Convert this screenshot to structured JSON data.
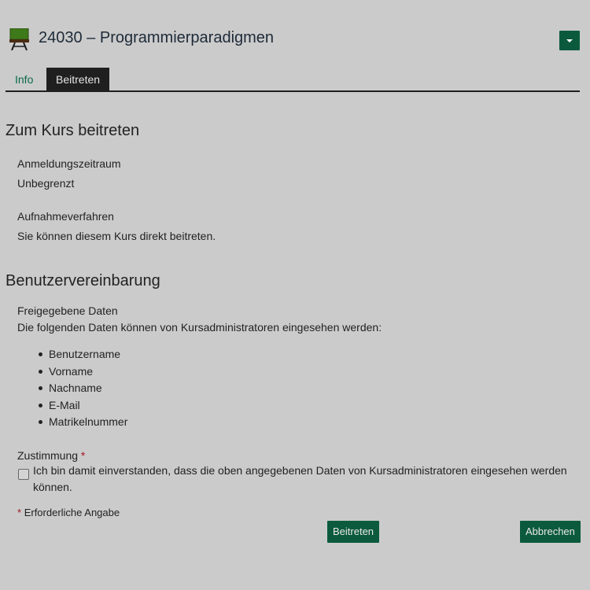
{
  "header": {
    "course_icon": "chalkboard-icon",
    "title": "24030 – Programmierparadigmen",
    "actions_icon": "caret-down-icon"
  },
  "tabs": [
    {
      "label": "Info",
      "active": false
    },
    {
      "label": "Beitreten",
      "active": true
    }
  ],
  "join_section": {
    "heading": "Zum Kurs beitreten",
    "registration_period_label": "Anmeldungszeitraum",
    "registration_period_value": "Unbegrenzt",
    "admission_label": "Aufnahmeverfahren",
    "admission_value": "Sie können diesem Kurs direkt beitreten."
  },
  "agreement_section": {
    "heading": "Benutzervereinbarung",
    "shared_data_label": "Freigegebene Daten",
    "shared_data_intro": "Die folgenden Daten können von Kursadministratoren eingesehen werden:",
    "shared_fields": [
      "Benutzername",
      "Vorname",
      "Nachname",
      "E-Mail",
      "Matrikelnummer"
    ],
    "consent_label": "Zustimmung",
    "required_marker": "*",
    "consent_checked": false,
    "consent_text": "Ich bin damit einverstanden, dass die oben angegebenen Daten von Kursadministratoren eingesehen werden können.",
    "required_note": "Erforderliche Angabe"
  },
  "buttons": {
    "join": "Beitreten",
    "cancel": "Abbrechen"
  },
  "colors": {
    "background": "#cbcbcb",
    "accent": "#0b5a3e",
    "tab_active": "#1f1f1f",
    "required": "#a3151d",
    "link": "#0b6a4a"
  }
}
